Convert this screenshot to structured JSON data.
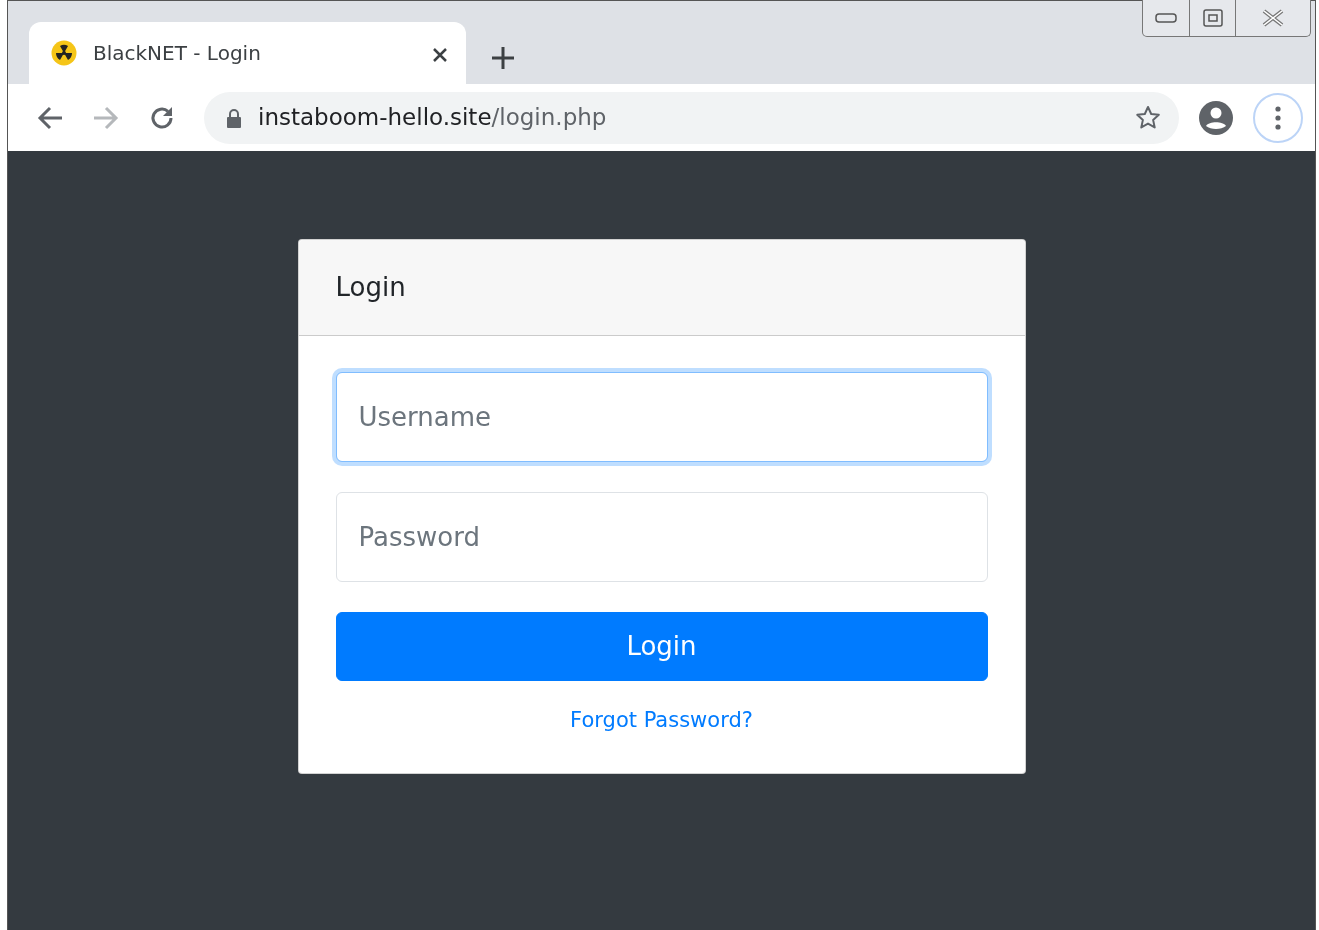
{
  "browser": {
    "tabs": [
      {
        "title": "BlackNET - Login",
        "selected": true
      }
    ],
    "address": {
      "domain": "instaboom-hello.site",
      "path": "/login.php"
    }
  },
  "login_card": {
    "title": "Login",
    "fields": [
      {
        "placeholder": "Username",
        "focused": true
      },
      {
        "placeholder": "Password",
        "focused": false
      }
    ],
    "button": "Login",
    "link": "Forgot Password?"
  }
}
